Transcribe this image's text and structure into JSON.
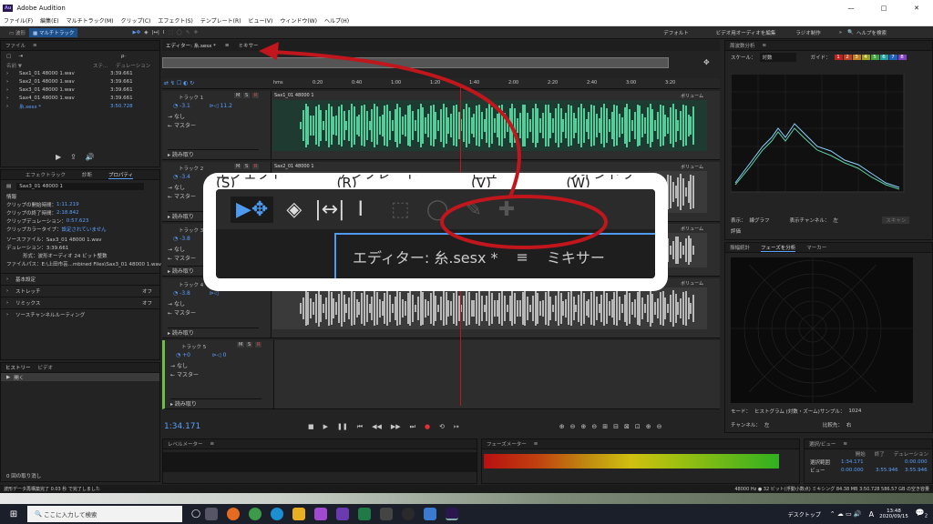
{
  "window": {
    "title": "Adobe Audition",
    "app_icon": "Au",
    "controls": [
      "—",
      "□",
      "✕"
    ]
  },
  "menu": [
    "ファイル(F)",
    "編集(E)",
    "マルチトラック(M)",
    "クリップ(C)",
    "エフェクト(S)",
    "テンプレート(R)",
    "ビュー(V)",
    "ウィンドウ(W)",
    "ヘルプ(H)"
  ],
  "toolbar": {
    "waveform": "波形",
    "multitrack": "マルチトラック",
    "workspaces": [
      "デフォルト",
      "ビデオ用オーディオを編集",
      "ラジオ制作"
    ],
    "search_placeholder": "ヘルプを検索"
  },
  "files_panel": {
    "title": "ファイル",
    "col_name": "名前 ▼",
    "col_status": "ステ...",
    "col_duration": "デュレーション",
    "files": [
      {
        "name": "Sax1_01 48000 1.wav",
        "duration": "3:39.661"
      },
      {
        "name": "Sax2_01 48000 1.wav",
        "duration": "3:39.661"
      },
      {
        "name": "Sax3_01 48000 1.wav",
        "duration": "3:39.661"
      },
      {
        "name": "Sax4_01 48000 1.wav",
        "duration": "3:39.661"
      },
      {
        "name": "糸.sesx *",
        "duration": "3:50.728"
      }
    ]
  },
  "props_panel": {
    "tabs": [
      "エフェクトラック",
      "診断",
      "プロパティ"
    ],
    "clip_name": "Sax3_01 48000 1",
    "section_info": "情報",
    "info": [
      [
        "クリップの開始時間：",
        "1:11.219"
      ],
      [
        "クリップの終了時間：",
        "2:18.842"
      ],
      [
        "クリップデュレーション：",
        "0:57.623"
      ],
      [
        "クリップカラータイプ：",
        "設定されていません"
      ]
    ],
    "source_file": "ソースファイル：Sax3_01 48000 1.wav",
    "duration": "デュレーション：3:39.661",
    "format": "形式：波形オーディオ 24 ビット整数",
    "path": "ファイルパス：E:\\上田市芸...mbined Files\\Sax3_01 48000 1.wav",
    "sections": [
      {
        "label": "基本設定",
        "val": ""
      },
      {
        "label": "ストレッチ",
        "val": "オフ"
      },
      {
        "label": "リミックス",
        "val": "オフ"
      },
      {
        "label": "ソースチャンネルルーティング",
        "val": ""
      }
    ]
  },
  "history_panel": {
    "tabs": [
      "ヒストリー",
      "ビデオ"
    ],
    "item": "開く",
    "status": "0 回の取り消し"
  },
  "editor": {
    "tab_editor": "エディター: 糸.sesx *",
    "tab_mixer": "ミキサー",
    "ruler": [
      "hms",
      "0:20",
      "0:40",
      "1:00",
      "1:20",
      "1:40",
      "2:00",
      "2:20",
      "2:40",
      "3:00",
      "3:20"
    ],
    "time": "1:34.171",
    "tracks": [
      {
        "name": "トラック 1",
        "clip": "Sax1_01 48000 1",
        "vol": "-3.1",
        "pan": "11.2",
        "color": "#3aa07a"
      },
      {
        "name": "トラック 2",
        "clip": "Sax2_01 48000 1",
        "vol": "-3.4",
        "pan": "",
        "color": "#9a9a9a"
      },
      {
        "name": "トラック 3",
        "clip": "",
        "vol": "-3.8",
        "pan": "",
        "color": "#9a9a9a"
      },
      {
        "name": "トラック 4",
        "clip": "",
        "vol": "-3.8",
        "pan": "",
        "color": "#9a9a9a"
      },
      {
        "name": "トラック 5",
        "clip": "",
        "vol": "+0",
        "pan": "0",
        "color": "#6cc04a"
      }
    ],
    "none": "なし",
    "master": "マスター",
    "read": "読み取り",
    "volume": "ボリューム"
  },
  "spectrum": {
    "title": "周波数分析",
    "scale_label": "スケール：",
    "scale": "対数",
    "guide_label": "ガイド：",
    "guides": [
      "1",
      "2",
      "3",
      "4",
      "5",
      "6",
      "7",
      "8"
    ],
    "display_label": "表示：",
    "display": "線グラフ",
    "channel_label": "表示チャンネル：",
    "channel": "左",
    "scan": "スキャン",
    "eval": "評価"
  },
  "phase": {
    "tabs": [
      "振幅統計",
      "フェーズを分析",
      "マーカー"
    ],
    "mode_label": "モード：",
    "mode": "ヒストグラム (対数・ズーム)",
    "sample_label": "サンプル：",
    "sample": "1024",
    "ch_label": "チャンネル：",
    "ch": "左",
    "compare_label": "比較先：",
    "compare": "右"
  },
  "level": {
    "title": "レベルメーター"
  },
  "phase_meter": {
    "title": "フェーズメーター"
  },
  "selection": {
    "title": "選択/ビュー",
    "headers": [
      "開始",
      "終了",
      "デュレーション"
    ],
    "rows": [
      [
        "選択範囲",
        "1:34.171",
        "",
        "0:00.000"
      ],
      [
        "ビュー",
        "0:00.000",
        "3:55.946",
        "3:55.946"
      ]
    ]
  },
  "status": {
    "left": "波形データ再構築完了 0.03 秒 で完了しました",
    "right": "48000 Hz ● 32 ビット(浮動小数点) ミキシング   84.38 MB   3:50.728   586.57 GB の空き容量"
  },
  "zoom_panel": {
    "menu": [
      "エフェクト(S)",
      "テンプレート(R)",
      "ビュー(V)",
      "ウィンドウ(W)"
    ],
    "editor_tab": "エディター: 糸.sesx *",
    "mixer_tab": "ミキサー"
  },
  "taskbar": {
    "search": "ここに入力して検索",
    "desktop": "デスクトップ",
    "time": "13:48",
    "date": "2020/09/15",
    "lang": "A",
    "notif": "2"
  },
  "accent": "#4e9af0",
  "annotation_color": "#c0161c"
}
